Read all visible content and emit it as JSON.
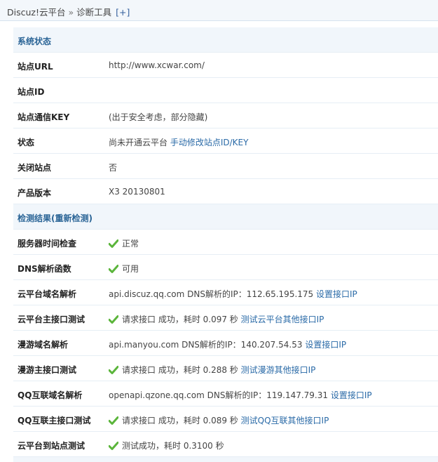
{
  "breadcrumb": {
    "root": "Discuz!云平台",
    "separator": "»",
    "current": "诊断工具",
    "toggle": "[+]"
  },
  "site_status": {
    "title": "系统状态",
    "rows": {
      "site_url": {
        "label": "站点URL",
        "value": "http://www.xcwar.com/"
      },
      "site_id": {
        "label": "站点ID",
        "value": ""
      },
      "site_key": {
        "label": "站点通信KEY",
        "value": "(出于安全考虑，部分隐藏)"
      },
      "status": {
        "label": "状态",
        "text": "尚未开通云平台",
        "link": "手动修改站点ID/KEY"
      },
      "site_closed": {
        "label": "关闭站点",
        "value": "否"
      },
      "version": {
        "label": "产品版本",
        "value": "X3 20130801"
      }
    }
  },
  "results": {
    "title": "检测结果",
    "recheck": "(重新检测)",
    "rows": {
      "server_time": {
        "label": "服务器时间检查",
        "value": "正常"
      },
      "dns_func": {
        "label": "DNS解析函数",
        "value": "可用"
      },
      "cloud_dns": {
        "label": "云平台域名解析",
        "text": "api.discuz.qq.com DNS解析的IP：112.65.195.175",
        "link": "设置接口IP"
      },
      "cloud_api": {
        "label": "云平台主接口测试",
        "text": "请求接口 成功，耗时 0.097 秒",
        "link": "测试云平台其他接口IP"
      },
      "manyou_dns": {
        "label": "漫游域名解析",
        "text": "api.manyou.com DNS解析的IP：140.207.54.53",
        "link": "设置接口IP"
      },
      "manyou_api": {
        "label": "漫游主接口测试",
        "text": "请求接口 成功，耗时 0.288 秒",
        "link": "测试漫游其他接口IP"
      },
      "qq_dns": {
        "label": "QQ互联域名解析",
        "text": "openapi.qzone.qq.com DNS解析的IP：119.147.79.31",
        "link": "设置接口IP"
      },
      "qq_api": {
        "label": "QQ互联主接口测试",
        "text": "请求接口 成功，耗时 0.089 秒",
        "link": "测试QQ互联其他接口IP"
      },
      "cloud_to_site": {
        "label": "云平台到站点测试",
        "value": "测试成功，耗时 0.3100 秒"
      }
    }
  },
  "colors": {
    "link": "#2a6aa7",
    "section_title": "#2a6496",
    "section_bg": "#f1f6fb",
    "check": "#5bb53b"
  },
  "icons": {
    "ok": "check-icon"
  }
}
